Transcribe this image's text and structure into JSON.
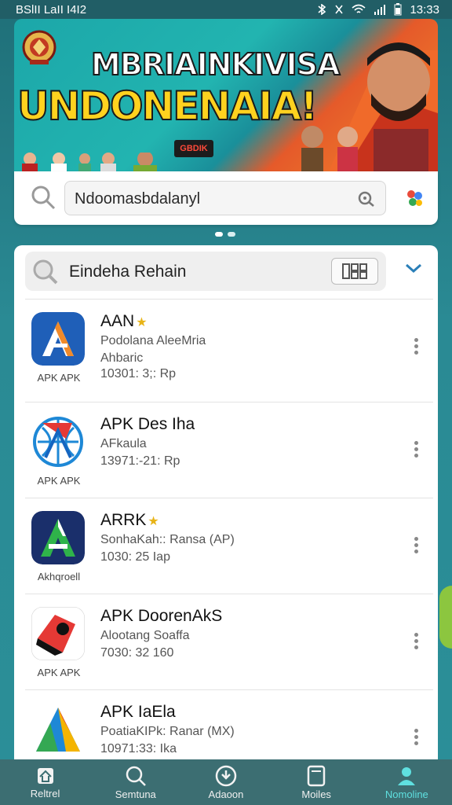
{
  "status_bar": {
    "left": "BSlII LaII I4I2",
    "time": "13:33"
  },
  "banner": {
    "line1": "MBRIAINKIVISA",
    "line2": "UNDONENAIA!",
    "badge": "GBDIK"
  },
  "search": {
    "value": "Ndoomasbdalanyl"
  },
  "list": {
    "filter_label": "Eindeha Rehain",
    "apps": [
      {
        "title": "AAN",
        "line2": "Podolana AleeMria",
        "line3": "Ahbaric",
        "line4": "10301: 3;: Rp",
        "sub": "APK APK",
        "starred": true
      },
      {
        "title": "APK Des Iha",
        "line2": "AFkaula",
        "line3": "13971:-21: Rp",
        "line4": "",
        "sub": "APK APK",
        "starred": false
      },
      {
        "title": "ARRK",
        "line2": "SonhaKah:: Ransa (AP)",
        "line3": "1030: 25 Iap",
        "line4": "",
        "sub": "Akhqroell",
        "starred": true
      },
      {
        "title": "APK DoorenAkS",
        "line2": "Alootang Soaffa",
        "line3": "7030: 32 160",
        "line4": "",
        "sub": "APK APK",
        "starred": false
      },
      {
        "title": "APK IaEla",
        "line2": "PoatiaKIPk: Ranar (MX)",
        "line3": "10971:33: Ika",
        "line4": "",
        "sub": "",
        "starred": false
      }
    ]
  },
  "nav": {
    "items": [
      {
        "label": "Reltrel",
        "icon": "home-icon"
      },
      {
        "label": "Semtuna",
        "icon": "search-icon"
      },
      {
        "label": "Adaoon",
        "icon": "download-icon"
      },
      {
        "label": "Moiles",
        "icon": "tablet-icon"
      },
      {
        "label": "Nomoline",
        "icon": "profile-icon"
      }
    ],
    "active_index": 4
  },
  "colors": {
    "accent": "#5fe0e0",
    "banner_yellow": "#ffd21f",
    "nav_bg": "#3c6e72"
  }
}
